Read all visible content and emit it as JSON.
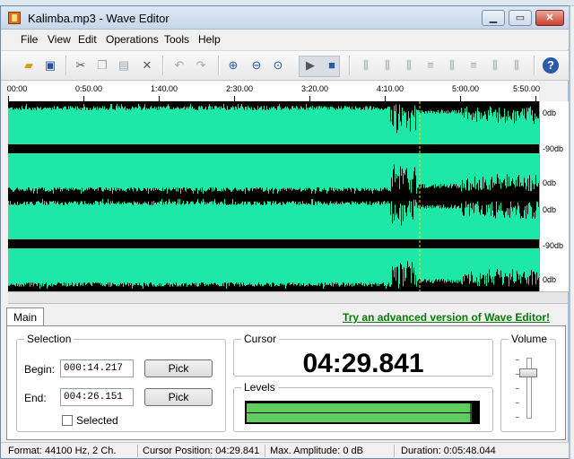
{
  "window": {
    "title": "Kalimba.mp3 - Wave Editor"
  },
  "menu": [
    "File",
    "View",
    "Edit",
    "Operations",
    "Tools",
    "Help"
  ],
  "toolbar": {
    "icons": [
      "open-folder-icon",
      "save-icon",
      "cut-icon",
      "copy-icon",
      "paste-icon",
      "delete-icon",
      "undo-icon",
      "redo-icon",
      "zoom-in-icon",
      "zoom-out-icon",
      "zoom-fit-icon",
      "play-icon",
      "stop-icon",
      "amplify-icon",
      "normalize-icon",
      "fade-in-icon",
      "fade-out-icon",
      "silence-icon",
      "reverse-icon",
      "invert-icon",
      "echo-icon",
      "help-icon"
    ]
  },
  "timeline": {
    "ticks": [
      "00:00",
      "0:50.00",
      "1:40.00",
      "2:30.00",
      "3:20.00",
      "4:10.00",
      "5:00.00",
      "5:50.00"
    ]
  },
  "db_scale": {
    "labels": [
      "0db",
      "-90db",
      "0db",
      "0db",
      "-90db",
      "0db"
    ]
  },
  "colors": {
    "waveform": "#1ee8a8",
    "cursor_line": "#ffd700",
    "link": "#0a7a0a",
    "level": "#5fcc5f"
  },
  "tabs": {
    "main": "Main"
  },
  "promo_link": "Try an advanced version of Wave Editor!",
  "selection": {
    "title": "Selection",
    "begin_label": "Begin:",
    "begin_value": "000:14.217",
    "end_label": "End:",
    "end_value": "004:26.151",
    "pick_label": "Pick",
    "selected_label": "Selected",
    "selected_checked": false
  },
  "cursor": {
    "title": "Cursor",
    "value": "04:29.841"
  },
  "levels": {
    "title": "Levels",
    "left_fraction": 0.98,
    "right_fraction": 0.98
  },
  "volume": {
    "title": "Volume",
    "level_fraction": 0.78
  },
  "status": {
    "format": "Format: 44100 Hz, 2 Ch.",
    "cursor_position": "Cursor Position: 04:29.841",
    "max_amplitude": "Max. Amplitude: 0 dB",
    "duration": "Duration: 0:05:48.044"
  }
}
